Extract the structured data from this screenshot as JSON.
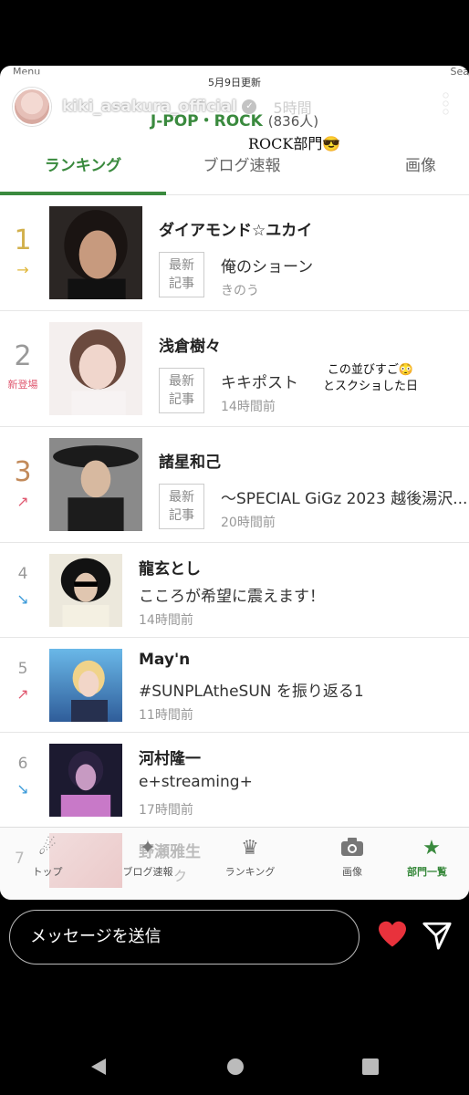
{
  "story": {
    "ghost_menu": "Menu",
    "ghost_search": "Sea",
    "updated": "5月9日更新",
    "username": "kiki_asakura_official",
    "timeago": "5時間",
    "sticker_rock": "ROCK部門😎",
    "sticker_note_line1": "この並びすご😳",
    "sticker_note_line2": "とスクショした日"
  },
  "genre": {
    "title": "J-POP・ROCK",
    "count": "(836人)"
  },
  "tabs": [
    {
      "label": "ランキング"
    },
    {
      "label": "ブログ速報"
    },
    {
      "label": "画像"
    }
  ],
  "latest_box": "最新記事",
  "rankings": [
    {
      "rank": "1",
      "trend": "→",
      "name": "ダイアモンド☆ユカイ",
      "post": "俺のショーン",
      "time": "きのう"
    },
    {
      "rank": "2",
      "trend": "新登場",
      "name": "浅倉樹々",
      "post": "キキポスト",
      "time": "14時間前"
    },
    {
      "rank": "3",
      "trend": "↗",
      "name": "諸星和己",
      "post": "〜SPECIAL GiGz 2023 越後湯沢...",
      "time": "20時間前"
    },
    {
      "rank": "4",
      "trend": "↘",
      "name": "龍玄とし",
      "post": "こころが希望に震えます！",
      "time": "14時間前"
    },
    {
      "rank": "5",
      "trend": "↗",
      "name": "May'n",
      "post": "#SUNPLAtheSUN を振り返る1",
      "time": "11時間前"
    },
    {
      "rank": "6",
      "trend": "↘",
      "name": "河村隆一",
      "post": "e+streaming+",
      "time": "17時間前"
    }
  ],
  "ghost_row": {
    "rank": "7",
    "name": "野瀬雅生",
    "sub": "ク"
  },
  "bottom_nav": [
    {
      "label": "トップ",
      "icon": "shooting-star-icon"
    },
    {
      "label": "ブログ速報",
      "icon": "sparkle-icon"
    },
    {
      "label": "ランキング",
      "icon": "crown-icon"
    },
    {
      "label": "画像",
      "icon": "camera-icon"
    },
    {
      "label": "部門一覧",
      "icon": "star-icon"
    }
  ],
  "message_placeholder": "メッセージを送信",
  "colors": {
    "accent_green": "#3a8a3e",
    "heart_red": "#e8323c"
  }
}
